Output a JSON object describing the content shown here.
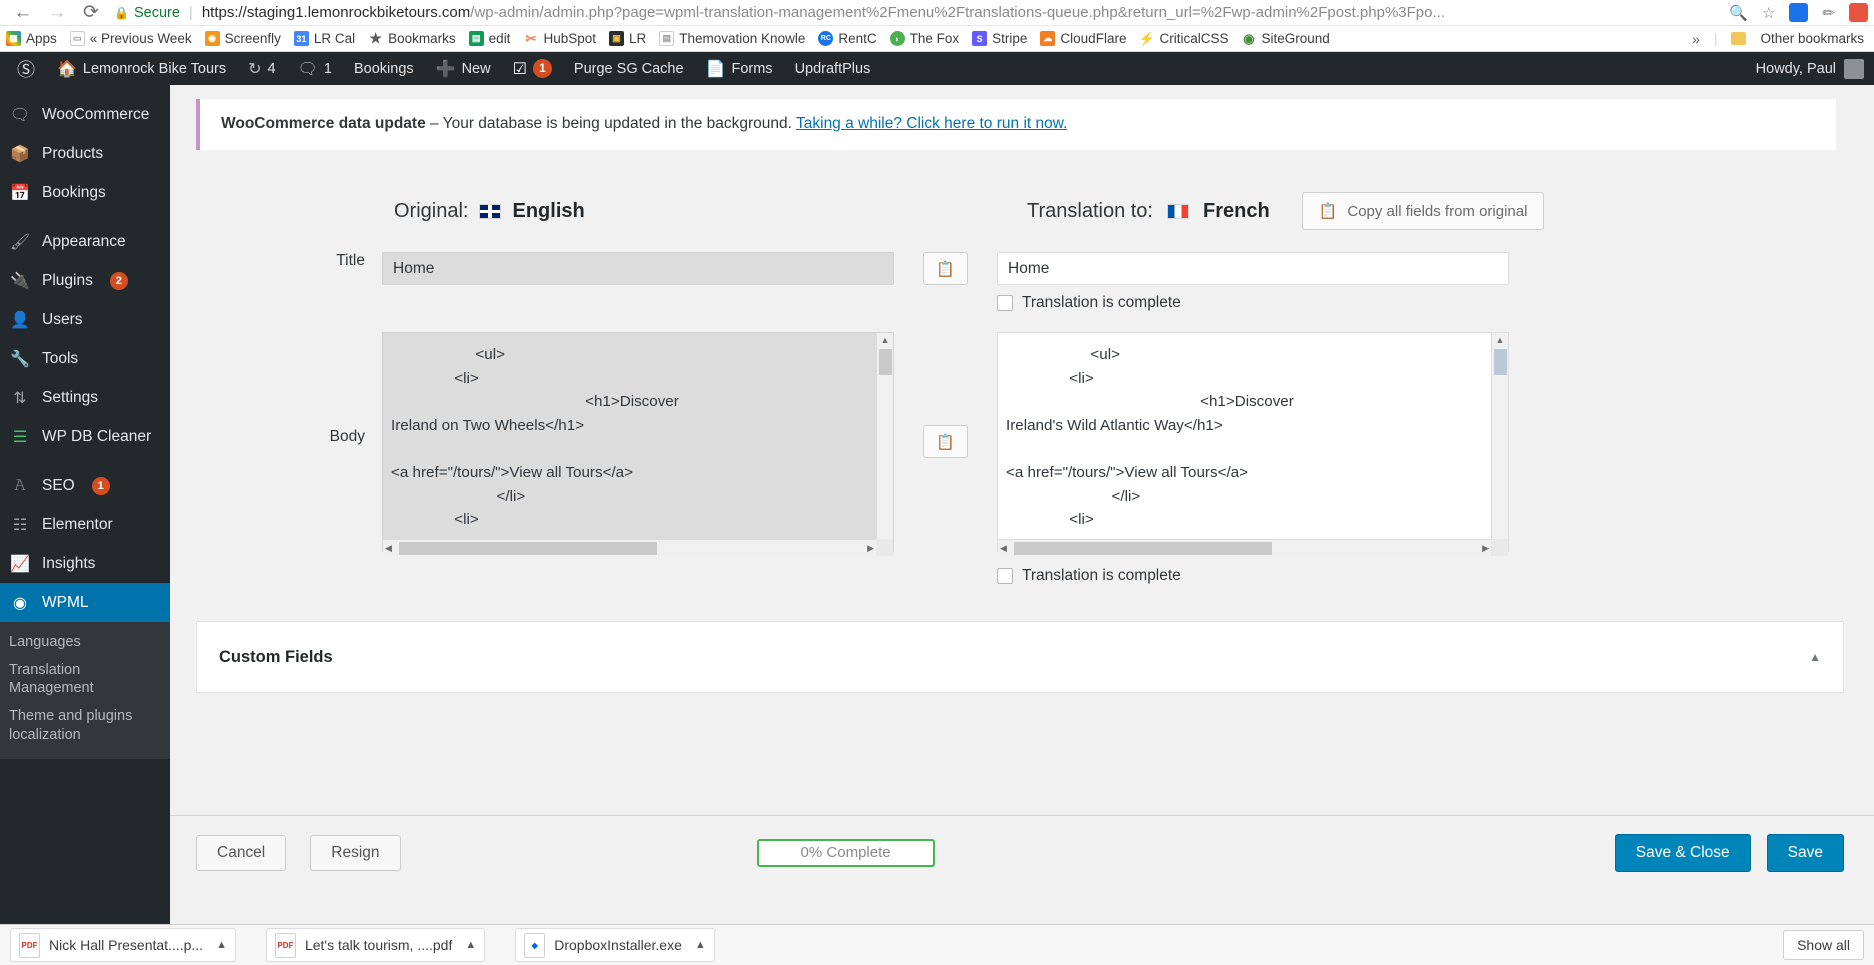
{
  "browser": {
    "back_icon": "←",
    "forward_icon": "→",
    "reload_icon": "⟳",
    "secure_label": "Secure",
    "url_host": "https://staging1.lemonrockbiketours.com",
    "url_path": "/wp-admin/admin.php?page=wpml-translation-management%2Fmenu%2Ftranslations-queue.php&return_url=%2Fwp-admin%2Fpost.php%3Fpo...",
    "zoom_icon": "search-icon",
    "star_icon": "☆",
    "overflow_icon": "»",
    "other_bookmarks_label": "Other bookmarks",
    "apps_label": "Apps",
    "bookmarks": [
      {
        "label": "« Previous Week",
        "color": "#ffffff",
        "letter": ""
      },
      {
        "label": "Screenfly",
        "color": "#f7941e",
        "letter": ""
      },
      {
        "label": "LR Cal",
        "color": "#4285f4",
        "letter": "31"
      },
      {
        "label": "Bookmarks",
        "color": "#5a5a5a",
        "letter": "★"
      },
      {
        "label": "edit",
        "color": "#0f9d58",
        "letter": "▤"
      },
      {
        "label": "HubSpot",
        "color": "#ff7a59",
        "letter": ""
      },
      {
        "label": "LR",
        "color": "#2d2d2d",
        "letter": ""
      },
      {
        "label": "Themovation Knowle",
        "color": "#ffffff",
        "letter": ""
      },
      {
        "label": "RentC",
        "color": "#1a73e8",
        "letter": "RC"
      },
      {
        "label": "The Fox",
        "color": "#4caf50",
        "letter": ""
      },
      {
        "label": "Stripe",
        "color": "#635bff",
        "letter": "S"
      },
      {
        "label": "CloudFlare",
        "color": "#f38020",
        "letter": ""
      },
      {
        "label": "CriticalCSS",
        "color": "#ffffff",
        "letter": "⚡"
      },
      {
        "label": "SiteGround",
        "color": "#ffffff",
        "letter": "◉"
      }
    ]
  },
  "adminbar": {
    "wp_logo": "wordpress-logo",
    "site_name": "Lemonrock Bike Tours",
    "updates_count": "4",
    "comments_count": "1",
    "bookings_label": "Bookings",
    "new_label": "New",
    "yoast_badge": "1",
    "purge_label": "Purge SG Cache",
    "forms_label": "Forms",
    "updraft_label": "UpdraftPlus",
    "howdy": "Howdy, Paul"
  },
  "sidebar": {
    "items": [
      {
        "label": "WooCommerce",
        "icon": "woo-icon",
        "badge": ""
      },
      {
        "label": "Products",
        "icon": "products-icon",
        "badge": ""
      },
      {
        "label": "Bookings",
        "icon": "calendar-icon",
        "badge": ""
      },
      {
        "label": "Appearance",
        "icon": "brush-icon",
        "badge": ""
      },
      {
        "label": "Plugins",
        "icon": "plug-icon",
        "badge": "2"
      },
      {
        "label": "Users",
        "icon": "user-icon",
        "badge": ""
      },
      {
        "label": "Tools",
        "icon": "wrench-icon",
        "badge": ""
      },
      {
        "label": "Settings",
        "icon": "sliders-icon",
        "badge": ""
      },
      {
        "label": "WP DB Cleaner",
        "icon": "database-icon",
        "badge": ""
      },
      {
        "label": "SEO",
        "icon": "yoast-icon",
        "badge": "1"
      },
      {
        "label": "Elementor",
        "icon": "elementor-icon",
        "badge": ""
      },
      {
        "label": "Insights",
        "icon": "insights-icon",
        "badge": ""
      },
      {
        "label": "WPML",
        "icon": "wpml-icon",
        "badge": ""
      }
    ],
    "submenu": [
      {
        "label": "Languages"
      },
      {
        "label": "Translation Management"
      },
      {
        "label": "Theme and plugins localization"
      }
    ]
  },
  "notice": {
    "title": "WooCommerce data update",
    "text": " – Your database is being updated in the background. ",
    "link": "Taking a while? Click here to run it now."
  },
  "translation": {
    "original_label": "Original:",
    "original_language": "English",
    "original_flag": "uk-flag-icon",
    "target_label": "Translation to:",
    "target_language": "French",
    "target_flag": "france-flag-icon",
    "copy_all_label": "Copy all fields from original",
    "copy_icon": "copy-icon",
    "fields": [
      {
        "label": "Title",
        "original": "Home",
        "translation": "Home",
        "complete_label": "Translation is complete",
        "complete_checked": false
      },
      {
        "label": "Body",
        "original": "                    <ul>\n               <li>\n                                              <h1>Discover\nIreland on Two Wheels</h1>\n\n<a href=\"/tours/\">View all Tours</a>\n                         </li>\n               <li>",
        "translation": "                    <ul>\n               <li>\n                                              <h1>Discover\nIreland's Wild Atlantic Way</h1>\n\n<a href=\"/tours/\">View all Tours</a>\n                         </li>\n               <li>",
        "complete_label": "Translation is complete",
        "complete_checked": false
      }
    ]
  },
  "custom_fields": {
    "title": "Custom Fields",
    "toggle_icon": "chevron-up-icon"
  },
  "actions": {
    "cancel_label": "Cancel",
    "resign_label": "Resign",
    "progress_label": "0% Complete",
    "progress_color": "#46b450",
    "save_close_label": "Save & Close",
    "save_label": "Save"
  },
  "downloads": {
    "items": [
      {
        "label": "Nick Hall Presentat....p...",
        "type": "pdf"
      },
      {
        "label": "Let's talk tourism, ....pdf",
        "type": "pdf"
      },
      {
        "label": "DropboxInstaller.exe",
        "type": "exe"
      }
    ],
    "show_all_label": "Show all"
  }
}
